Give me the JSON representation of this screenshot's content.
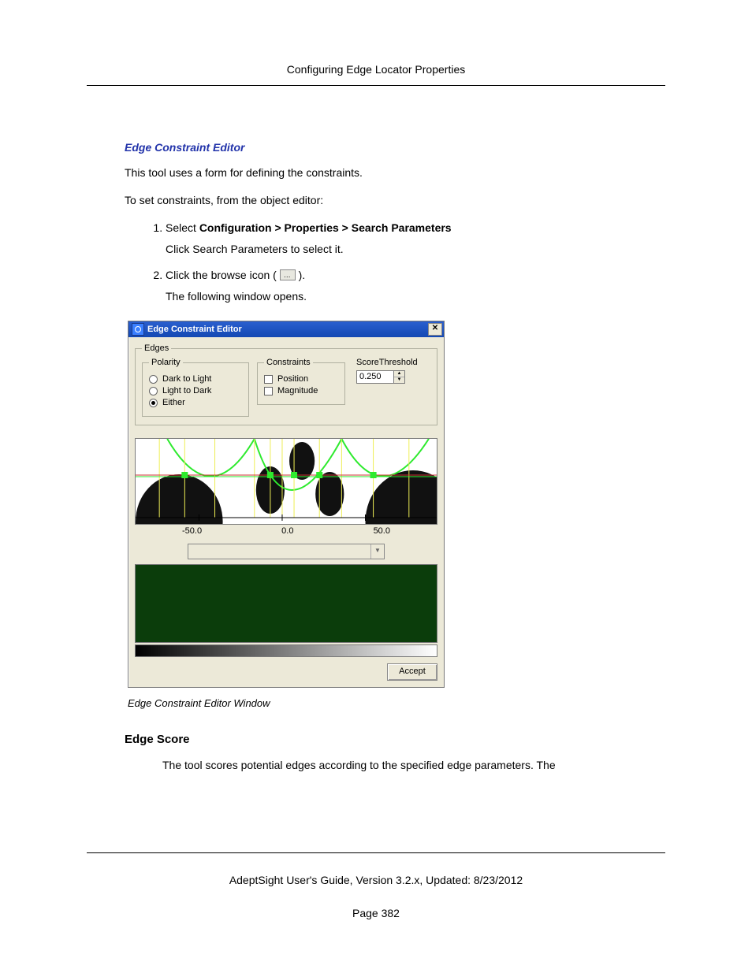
{
  "header": {
    "title": "Configuring Edge Locator Properties"
  },
  "section": {
    "title": "Edge Constraint Editor",
    "intro1": "This tool uses a form for defining the constraints.",
    "intro2": "To set constraints, from the object editor:"
  },
  "steps": {
    "s1_prefix": "Select ",
    "s1_bold": "Configuration > Properties > Search Parameters",
    "s1_sub": "Click Search Parameters to select it.",
    "s2_prefix": "Click the browse icon ( ",
    "s2_suffix": " ).",
    "s2_sub": "The following window opens."
  },
  "dialog": {
    "title": "Edge Constraint Editor",
    "close": "✕",
    "edges_legend": "Edges",
    "polarity": {
      "legend": "Polarity",
      "opt1": "Dark to Light",
      "opt2": "Light to Dark",
      "opt3": "Either",
      "selected": "opt3"
    },
    "constraints": {
      "legend": "Constraints",
      "chk1": "Position",
      "chk2": "Magnitude"
    },
    "threshold": {
      "label": "ScoreThreshold",
      "value": "0.250"
    },
    "axis": {
      "left": "-50.0",
      "mid": "0.0",
      "right": "50.0"
    },
    "accept": "Accept"
  },
  "caption": "Edge Constraint Editor Window",
  "edgescore": {
    "heading": "Edge Score",
    "text": "The tool scores potential edges according to the specified edge parameters. The"
  },
  "footer": {
    "line": "AdeptSight User's Guide,  Version 3.2.x, Updated: 8/23/2012",
    "page": "Page 382"
  }
}
